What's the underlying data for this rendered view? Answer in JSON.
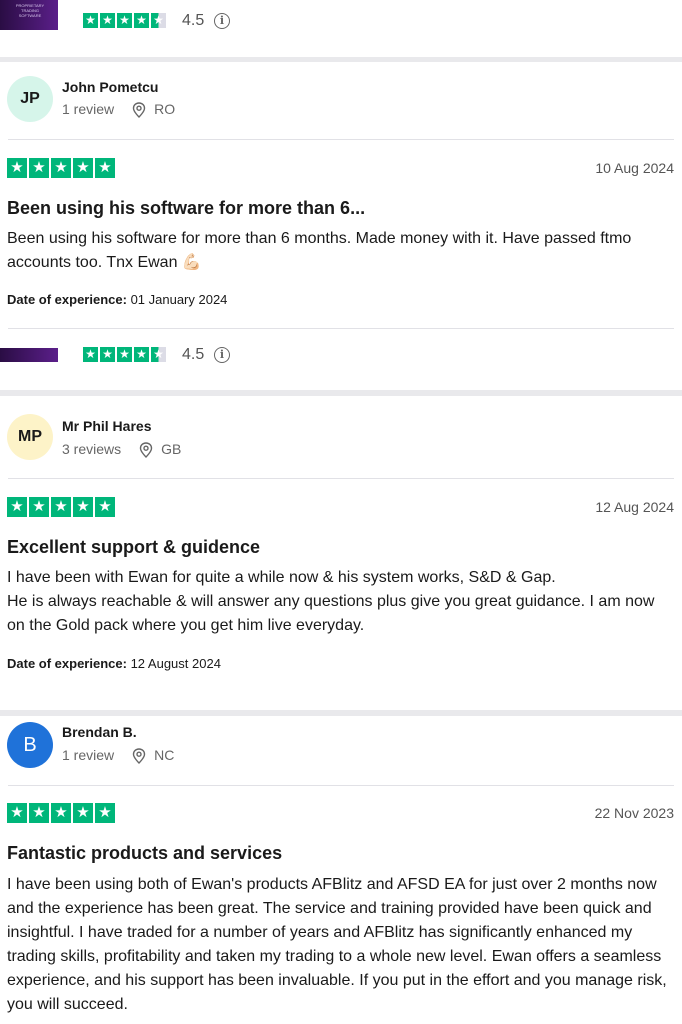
{
  "company": {
    "logo_text": "PROPRIETARY TRADING SOFTWARE",
    "rating_value": "4.5",
    "rating_stars": 4.5
  },
  "reviews": [
    {
      "initials": "JP",
      "avatar_color": "#d6f5ea",
      "name": "John Pometcu",
      "review_count": "1 review",
      "country": "RO",
      "stars": 5,
      "date": "10 Aug 2024",
      "title": "Been using his software for more than 6...",
      "body": "Been using his software for more than 6 months. Made money with it. Have passed ftmo accounts too. Tnx Ewan 💪🏻",
      "experience_label": "Date of experience:",
      "experience_date": "01 January 2024"
    },
    {
      "initials": "MP",
      "avatar_color": "#fdf3c8",
      "name": "Mr Phil Hares",
      "review_count": "3 reviews",
      "country": "GB",
      "stars": 5,
      "date": "12 Aug 2024",
      "title": "Excellent support & guidence",
      "body_lines": [
        "I have been with Ewan for quite a while now & his system works, S&D & Gap.",
        "He is always reachable & will answer any questions plus give you great guidance. I am now on the Gold pack where you get him live everyday."
      ],
      "experience_label": "Date of experience:",
      "experience_date": "12 August 2024"
    },
    {
      "initials": "B",
      "avatar_color": "#1f72d9",
      "name": "Brendan B.",
      "review_count": "1 review",
      "country": "NC",
      "stars": 5,
      "date": "22 Nov 2023",
      "title": "Fantastic products and services",
      "body": "I have been using both of Ewan's products AFBlitz and AFSD EA for just over 2 months now and the experience has been great. The service and training provided have been quick and insightful. I have traded for a number of years and AFBlitz has significantly enhanced my trading skills, profitability and taken my trading to a whole new level. Ewan offers a seamless experience, and his support has been invaluable. If you put in the effort and you manage risk, you will succeed."
    }
  ],
  "icons": {
    "star": "star-icon",
    "location": "location-pin-icon",
    "info": "info-icon"
  },
  "colors": {
    "trustpilot_green": "#00b67a",
    "empty_star": "#dcdce6"
  }
}
